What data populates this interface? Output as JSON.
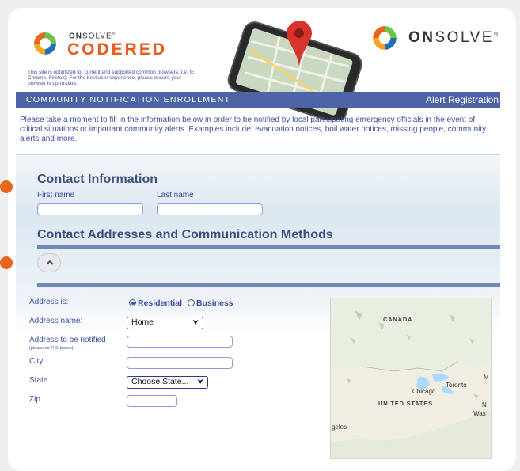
{
  "brand": {
    "product_prefix": "ON",
    "product_suffix": "SOLVE",
    "product_tm": "®",
    "product_name": "CODERED",
    "company_prefix": "ON",
    "company_suffix": "SOLVE",
    "company_tm": "®",
    "browser_note": "This site is optimized for current and supported common browsers (i.e. IE, Chrome, Firefox). For the best user experience, please ensure your browser is up-to-date."
  },
  "banner": {
    "left": "COMMUNITY NOTIFICATION ENROLLMENT",
    "right": "Alert Registration"
  },
  "intro": "Please take a moment to fill in the information below in order to be notified by local participating emergency officials in the event of critical situations or important community alerts. Examples include: evacuation notices, boil water notices, missing people, community alerts and more.",
  "contact": {
    "title": "Contact Information",
    "first_name_label": "First name",
    "last_name_label": "Last name",
    "first_name_value": "",
    "last_name_value": ""
  },
  "addresses": {
    "title": "Contact Addresses and Communication Methods",
    "address_is_label": "Address is:",
    "option_residential": "Residential",
    "option_business": "Business",
    "selected_option": "Residential",
    "address_name_label": "Address name:",
    "address_name_value": "Home",
    "address_label": "Address to be notified",
    "address_hint": "(please no P.O. boxes)",
    "address_value": "",
    "city_label": "City",
    "city_value": "",
    "state_label": "State",
    "state_value": "Choose State...",
    "zip_label": "Zip",
    "zip_value": ""
  },
  "map": {
    "labels": {
      "canada": "CANADA",
      "united_states": "UNITED STATES",
      "toronto": "Toronto",
      "chicago": "Chicago",
      "was": "Was",
      "geles": "geles",
      "m": "M",
      "n": "N"
    }
  },
  "colors": {
    "accent_orange": "#e7661c",
    "banner_blue": "#4c63a6",
    "text_blue": "#3d4fa1",
    "title_navy": "#3d4f7c"
  },
  "icons": {
    "collapse": "chevron-up-icon",
    "logo": "onsolve-ring-logo",
    "phone": "smartphone-map-pin-illustration"
  }
}
